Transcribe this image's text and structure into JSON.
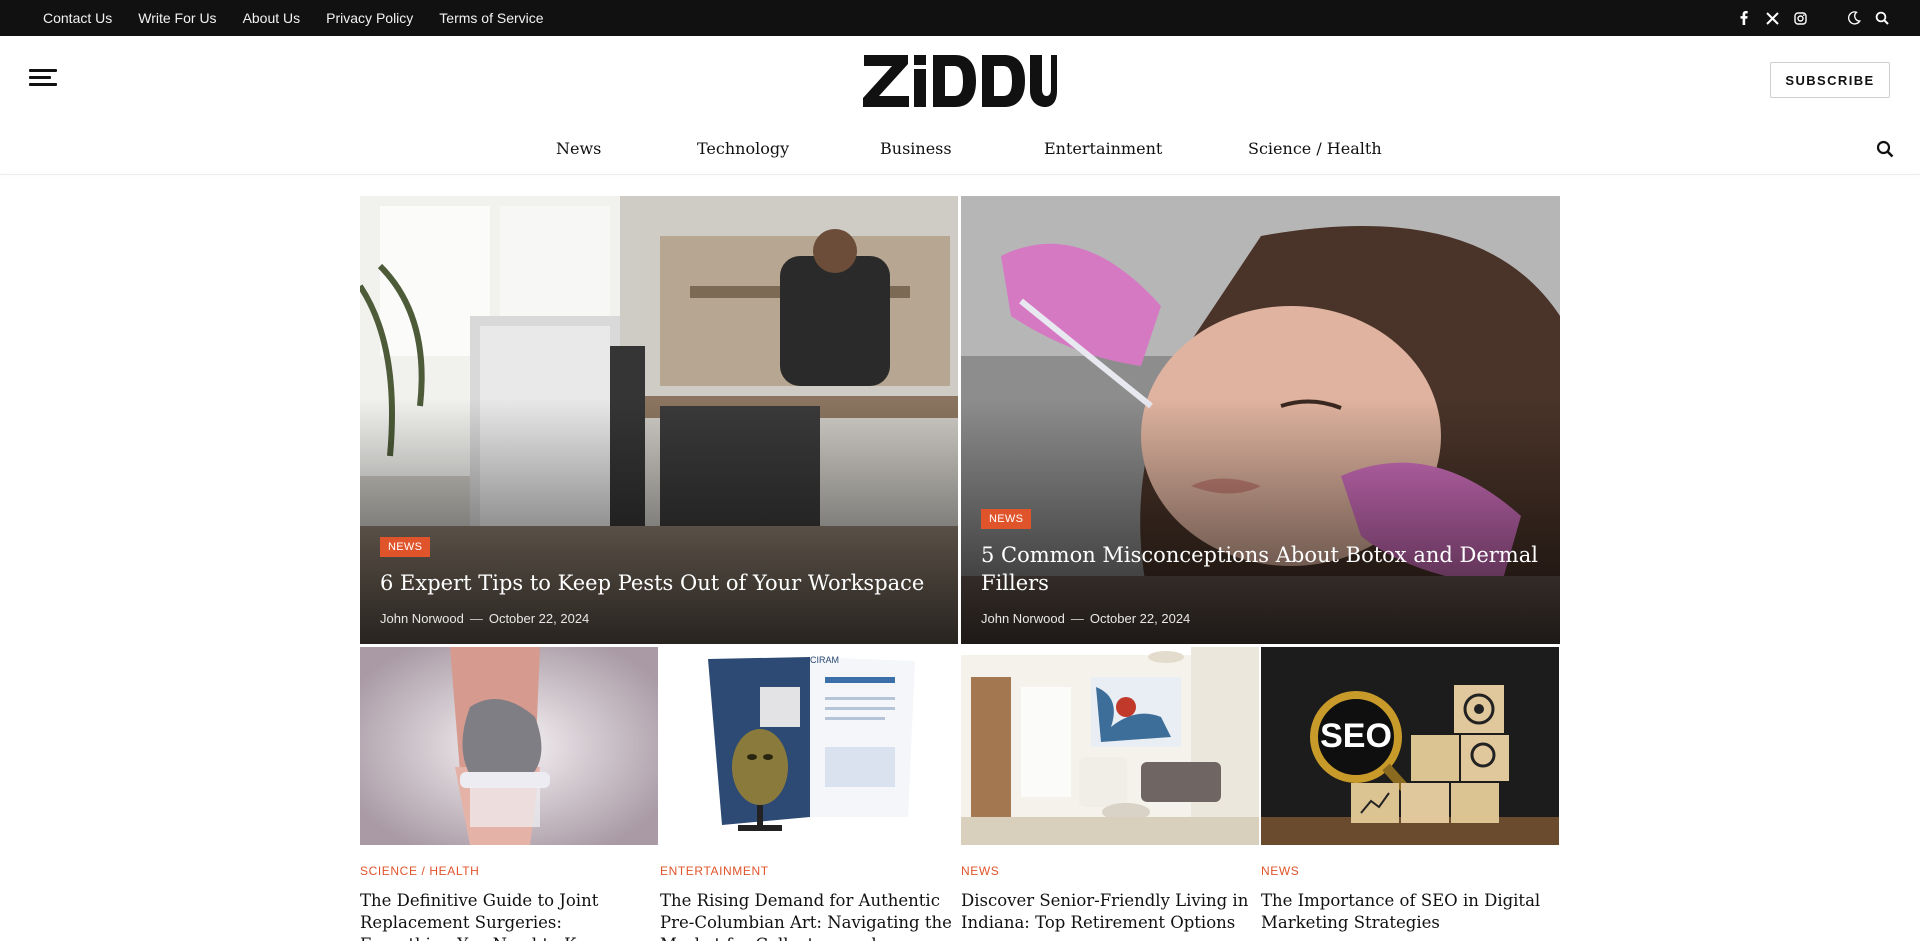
{
  "topbar": {
    "links": [
      "Contact Us",
      "Write For Us",
      "About Us",
      "Privacy Policy",
      "Terms of Service"
    ],
    "icons": [
      "facebook-icon",
      "x-twitter-icon",
      "instagram-icon",
      "moon-icon",
      "search-icon"
    ]
  },
  "header": {
    "logo_text": "ZIDDU",
    "subscribe_label": "SUBSCRIBE"
  },
  "nav": {
    "items": [
      "News",
      "Technology",
      "Business",
      "Entertainment",
      "Science / Health"
    ]
  },
  "featured": [
    {
      "category": "NEWS",
      "title": "6 Expert Tips to Keep Pests Out of Your Workspace",
      "author": "John Norwood",
      "separator": "—",
      "date": "October 22, 2024"
    },
    {
      "category": "NEWS",
      "title": "5 Common Misconceptions About Botox and Dermal Fillers",
      "author": "John Norwood",
      "separator": "—",
      "date": "October 22, 2024"
    }
  ],
  "cards": [
    {
      "category": "SCIENCE / HEALTH",
      "title": "The Definitive Guide to Joint Replacement Surgeries: Everything You Need to Know"
    },
    {
      "category": "ENTERTAINMENT",
      "title": "The Rising Demand for Authentic Pre-Columbian Art: Navigating the Market for Collectors and Investors"
    },
    {
      "category": "NEWS",
      "title": "Discover Senior-Friendly Living in Indiana: Top Retirement Options"
    },
    {
      "category": "NEWS",
      "title": "The Importance of SEO in Digital Marketing Strategies"
    }
  ],
  "thumb_text": {
    "seo": "SEO",
    "ciram": "CIRAM"
  },
  "colors": {
    "accent": "#e0542b",
    "topbar_bg": "#111111"
  }
}
